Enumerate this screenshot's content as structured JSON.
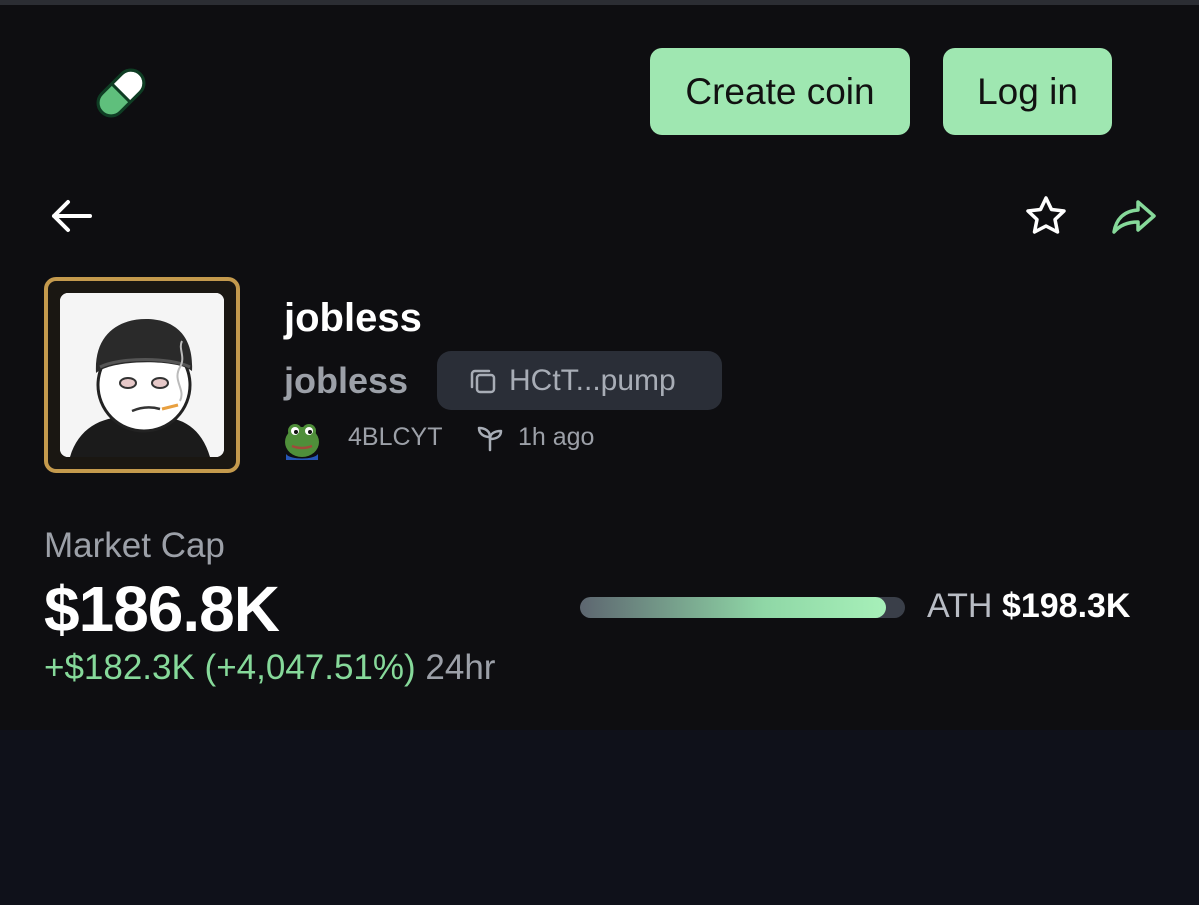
{
  "header": {
    "logo_icon": "pill-icon",
    "create_coin_label": "Create coin",
    "login_label": "Log in",
    "accent_color": "#9fe7b1"
  },
  "nav": {
    "back_icon": "arrow-left-icon",
    "favorite_icon": "star-icon",
    "share_icon": "share-arrow-icon"
  },
  "coin": {
    "name": "jobless",
    "ticker": "jobless",
    "contract_short": "HCtT...pump",
    "copy_icon": "copy-icon",
    "creator": "4BLCYT",
    "created_icon": "sprout-icon",
    "age": "1h ago"
  },
  "market": {
    "label": "Market Cap",
    "value": "$186.8K",
    "change": "+$182.3K (+4,047.51%)",
    "period": "24hr",
    "ath_label": "ATH",
    "ath_value": "$198.3K",
    "ath_progress": 0.942,
    "positive_color": "#86d99a"
  }
}
